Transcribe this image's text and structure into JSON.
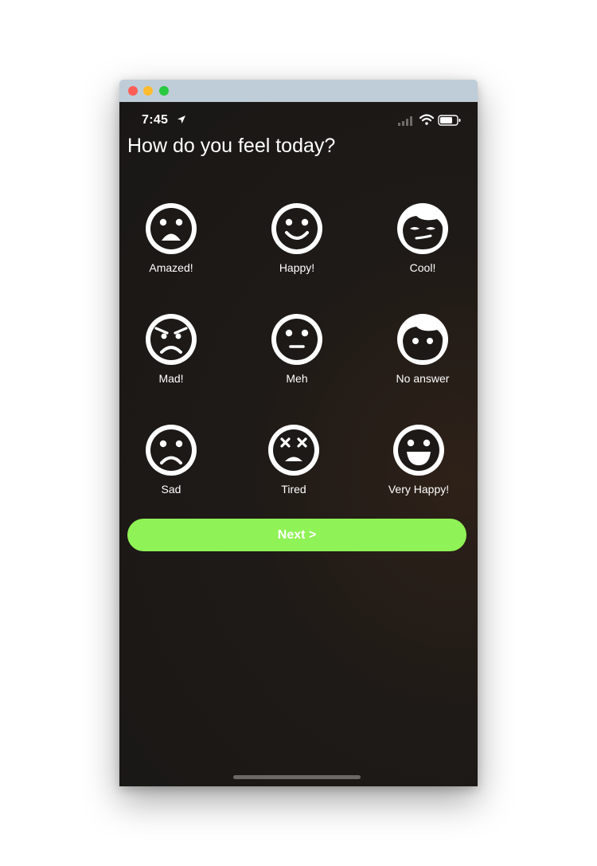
{
  "status_bar": {
    "time": "7:45"
  },
  "question": "How do you feel today?",
  "moods": [
    {
      "label": "Amazed!",
      "icon": "amazed-face-icon"
    },
    {
      "label": "Happy!",
      "icon": "happy-face-icon"
    },
    {
      "label": "Cool!",
      "icon": "cool-face-icon"
    },
    {
      "label": "Mad!",
      "icon": "mad-face-icon"
    },
    {
      "label": "Meh",
      "icon": "meh-face-icon"
    },
    {
      "label": "No answer",
      "icon": "no-answer-face-icon"
    },
    {
      "label": "Sad",
      "icon": "sad-face-icon"
    },
    {
      "label": "Tired",
      "icon": "tired-face-icon"
    },
    {
      "label": "Very Happy!",
      "icon": "very-happy-face-icon"
    }
  ],
  "next_button": {
    "label": "Next >"
  },
  "colors": {
    "accent": "#8ff256",
    "background": "#1b1816",
    "foreground": "#ffffff"
  }
}
